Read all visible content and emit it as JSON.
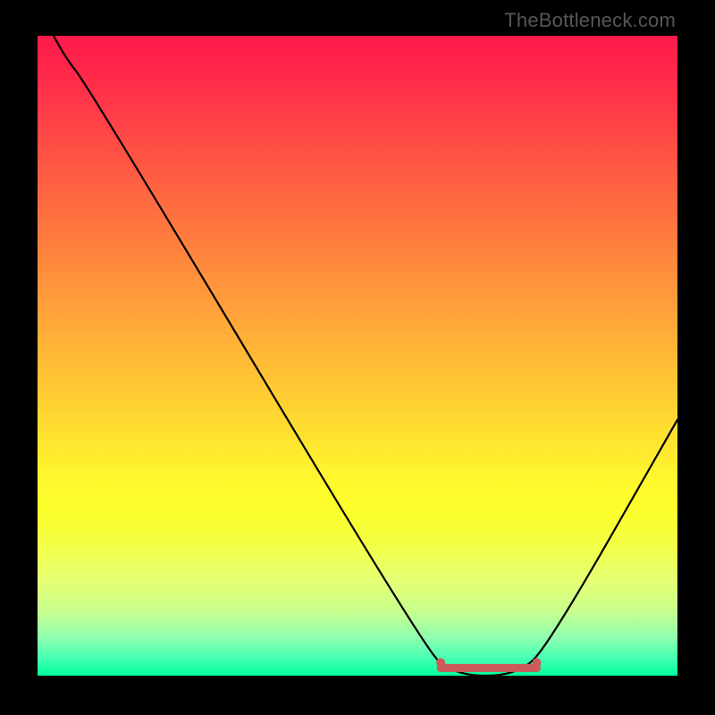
{
  "watermark": "TheBottleneck.com",
  "chart_data": {
    "type": "line",
    "title": "",
    "xlabel": "",
    "ylabel": "",
    "xlim": [
      0,
      100
    ],
    "ylim": [
      0,
      100
    ],
    "series": [
      {
        "name": "curve",
        "x": [
          0,
          4,
          8,
          60,
          65,
          75,
          80,
          100
        ],
        "y": [
          105,
          97,
          92,
          5,
          0,
          0,
          5,
          40
        ]
      }
    ],
    "highlight": {
      "name": "valley-mark",
      "color": "#cc5a5a",
      "x": [
        63,
        78
      ],
      "y": [
        1.2,
        1.2
      ]
    },
    "background_gradient": {
      "top": "#ff1a4b",
      "mid": "#ffe330",
      "bottom": "#00ff9d"
    }
  }
}
